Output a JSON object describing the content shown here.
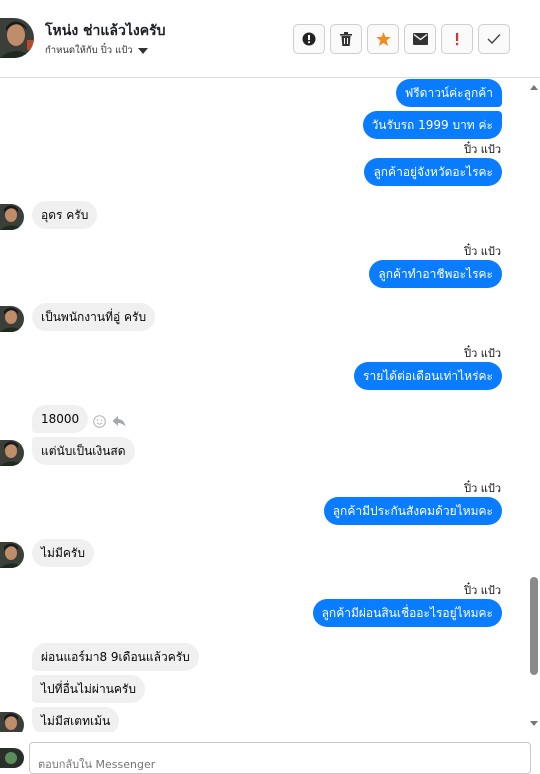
{
  "header": {
    "contact_name": "โหน่ง ช่าแล้วไงครับ",
    "assignee_label": "กำหนดให้กับ ปิ๋ว แป้ว",
    "toolbar_icons": [
      "alert-circle-icon",
      "trash-icon",
      "star-icon",
      "envelope-icon",
      "exclamation-icon",
      "check-icon"
    ]
  },
  "colors": {
    "outgoing_bubble": "#0a7cff",
    "incoming_bubble": "#f0f0f0",
    "star": "#f5891f",
    "exclamation": "#e02d2d"
  },
  "messages": {
    "m1": "ฟรีดาวน์ค่ะลูกค้า",
    "m2": "วันรับรถ 1999 บาท ค่ะ",
    "s1": "ปิ๋ว แป้ว",
    "m3": "ลูกค้าอยู่จังหวัดอะไรคะ",
    "m4": "อุดร ครับ",
    "s2": "ปิ๋ว แป้ว",
    "m5": "ลูกค้าทำอาชีพอะไรคะ",
    "m6": "เป็นพนักงานที่อู่ ครับ",
    "s3": "ปิ๋ว แป้ว",
    "m7": "รายได้ต่อเดือนเท่าไหร่คะ",
    "m8": "18000",
    "m9": "แต่นับเป็นเงินสด",
    "s4": "ปิ๋ว แป้ว",
    "m10": "ลูกค้ามีประกันสังคมด้วยไหมคะ",
    "m11": "ไม่มีครับ",
    "s5": "ปิ๋ว แป้ว",
    "m12": "ลูกค้ามีผ่อนสินเชื่ออะไรอยู่ไหมคะ",
    "m13": "ผ่อนแอร์มา8 9เดือนแล้วครับ",
    "m14": "ไปที่อื่นไม่ผ่านครับ",
    "m15": "ไม่มีสเตทเม้น"
  },
  "composer": {
    "placeholder": "ตอบกลับใน Messenger"
  }
}
